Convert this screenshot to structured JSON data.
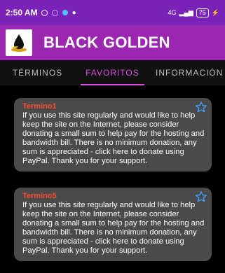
{
  "statusbar": {
    "time": "2:50 AM",
    "network": "4G",
    "battery": "75"
  },
  "appbar": {
    "title": "BLACK GOLDEN",
    "logo_icon": "oil-drop-logo"
  },
  "tabs": [
    {
      "label": "TÉRMINOS",
      "active": false
    },
    {
      "label": "FAVORITOS",
      "active": true
    },
    {
      "label": "INFORMACIÓN",
      "active": false
    }
  ],
  "cards": [
    {
      "title": "Termino1",
      "text": "If you use this site regularly and would like to help keep the site on the Internet, please consider donating a small sum to help pay for the hosting and bandwidth bill. There is no minimum donation, any sum is appreciated - click here to donate using PayPal. Thank you for your support.",
      "favorite_icon": "star-outline-icon"
    },
    {
      "title": "Termino5",
      "text": "If you use this site regularly and would like to help keep the site on the Internet, please consider donating a small sum to help pay for the hosting and bandwidth bill. There is no minimum donation, any sum is appreciated - click here to donate using PayPal. Thank you for your support.",
      "favorite_icon": "star-outline-icon"
    }
  ],
  "colors": {
    "statusbar": "#7b22b8",
    "appbar": "#9b27b0",
    "tab_active": "#e04de9",
    "card_bg": "#4a4a4a",
    "card_title": "#ff4a2d",
    "star": "#3fa3ff"
  }
}
